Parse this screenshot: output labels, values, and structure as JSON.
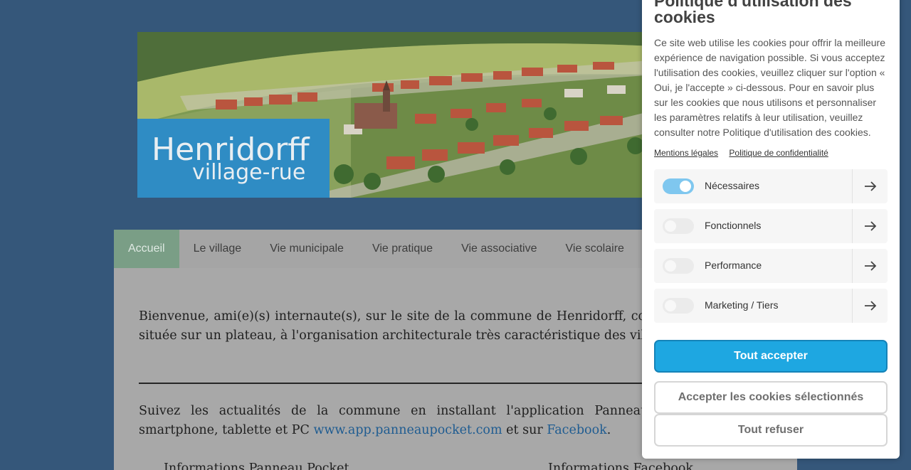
{
  "banner": {
    "logo_line1": "Henridorff",
    "logo_line2": "village-rue"
  },
  "nav": {
    "items": [
      "Accueil",
      "Le village",
      "Vie municipale",
      "Vie pratique",
      "Vie associative",
      "Vie scolaire"
    ],
    "active_index": 0
  },
  "content": {
    "intro": "Bienvenue, ami(e)(s) internaute(s), sur le site de la commune de Henridorff, commune mosellane, située sur un plateau, à l'organisation architecturale très caractéristique des villages lorrains.",
    "follow_text": "Suivez les actualités de la commune en installant l'application PanneauPocket sur votre smartphone, tablette et PC",
    "follow_link1": "www.app.panneaupocket.com",
    "follow_and": "et sur",
    "follow_link2": "Facebook",
    "follow_end": ".",
    "subhead_left": "Informations Panneau Pocket",
    "subhead_right": "Informations Facebook"
  },
  "cookie": {
    "title": "Politique d'utilisation des cookies",
    "text": "Ce site web utilise les cookies pour offrir la meilleure expérience de navigation possible. Si vous acceptez l'utilisation des cookies, veuillez cliquer sur l'option « Oui, je l'accepte » ci-dessous. Pour en savoir plus sur les cookies que nous utilisons et personnaliser les paramètres relatifs à leur utilisation, veuillez consulter notre Politique d'utilisation des cookies.",
    "link_legal": "Mentions légales",
    "link_privacy": "Politique de confidentialité",
    "categories": [
      {
        "label": "Nécessaires",
        "enabled": true
      },
      {
        "label": "Fonctionnels",
        "enabled": false
      },
      {
        "label": "Performance",
        "enabled": false
      },
      {
        "label": "Marketing / Tiers",
        "enabled": false
      }
    ],
    "accept_all": "Tout accepter",
    "accept_selected": "Accepter les cookies sélectionnés",
    "refuse_all": "Tout refuser"
  },
  "colors": {
    "page_bg": "#35577a",
    "nav_active": "#7a9e86",
    "accent_blue": "#1ea7e1",
    "logo_blue": "#2f8cc4",
    "link": "#1f5c91"
  },
  "icons": [
    "arrow-right-icon"
  ]
}
